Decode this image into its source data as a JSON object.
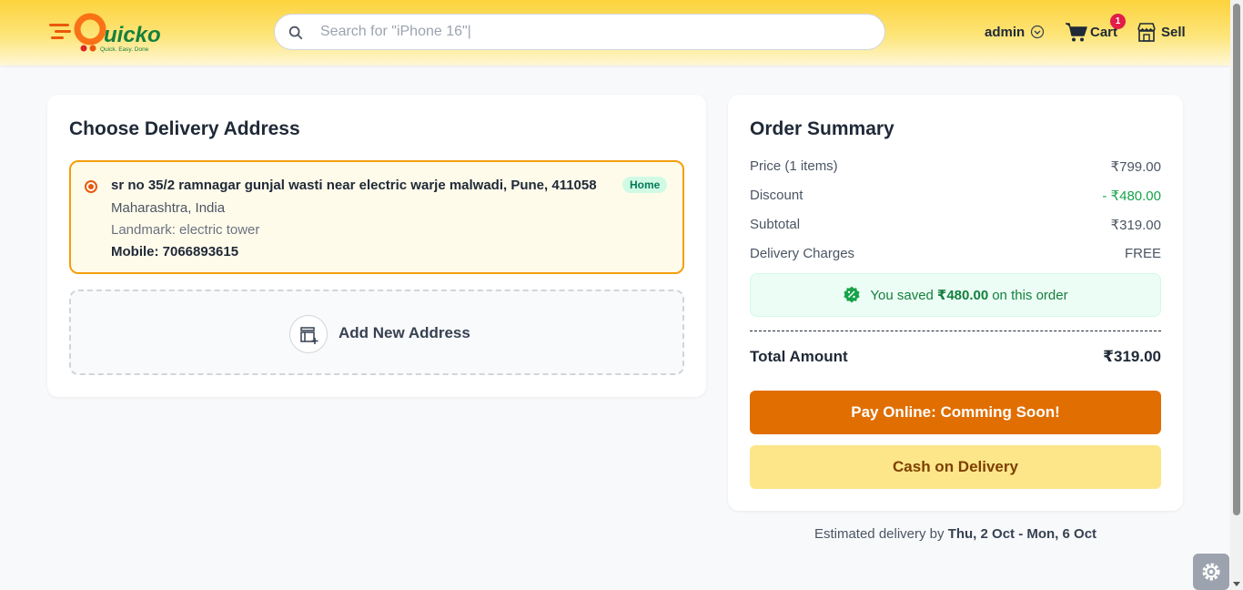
{
  "header": {
    "logo_text": "Quicko",
    "logo_tagline": "Quick. Easy. Done",
    "search_placeholder": "Search for \"iPhone 16\"|",
    "user_label": "admin",
    "cart_label": "Cart",
    "cart_count": "1",
    "sell_label": "Sell"
  },
  "delivery": {
    "title": "Choose Delivery Address",
    "address": {
      "line1": "sr no 35/2 ramnagar gunjal wasti near electric warje malwadi, Pune, 411058",
      "line2": "Maharashtra, India",
      "landmark": "Landmark: electric tower",
      "mobile": "Mobile: 7066893615",
      "tag": "Home",
      "selected": true
    },
    "add_new_label": "Add New Address"
  },
  "summary": {
    "title": "Order Summary",
    "rows": [
      {
        "label": "Price (1 items)",
        "value": "₹799.00"
      },
      {
        "label": "Discount",
        "value": "- ₹480.00"
      },
      {
        "label": "Subtotal",
        "value": "₹319.00"
      },
      {
        "label": "Delivery Charges",
        "value": "FREE"
      }
    ],
    "saved_prefix": "You saved",
    "saved_amount": "₹480.00",
    "saved_suffix": "on this order",
    "total_label": "Total Amount",
    "total_value": "₹319.00",
    "pay_online_label": "Pay Online: Comming Soon!",
    "cod_label": "Cash on Delivery"
  },
  "eta": {
    "prefix": "Estimated delivery by",
    "dates": "Thu, 2 Oct - Mon, 6 Oct"
  },
  "colors": {
    "accent": "#e06e00",
    "header_yellow": "#fdd33d",
    "success_green": "#16a34a"
  },
  "icons": [
    "search-icon",
    "chevron-down-icon",
    "cart-icon",
    "store-icon",
    "add-location-icon",
    "discount-badge-icon",
    "settings-gear-icon"
  ]
}
